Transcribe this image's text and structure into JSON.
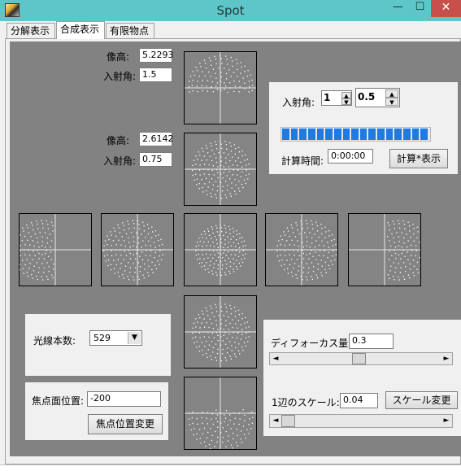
{
  "window": {
    "title": "Spot",
    "minimize_glyph": "—",
    "maximize_glyph": "☐",
    "close_glyph": "✕",
    "icon": "app-icon"
  },
  "tabs": [
    {
      "label": "分解表示",
      "selected": false
    },
    {
      "label": "合成表示",
      "selected": true
    },
    {
      "label": "有限物点",
      "selected": false
    }
  ],
  "top_spot": {
    "image_height_label": "像高:",
    "image_height_value": "5.2293",
    "incident_angle_label": "入射角:",
    "incident_angle_value": "1.5"
  },
  "mid_spot": {
    "image_height_label": "像高:",
    "image_height_value": "2.6142",
    "incident_angle_label": "入射角:",
    "incident_angle_value": "0.75"
  },
  "calc_panel": {
    "incident_angle_label": "入射角:",
    "spin1_value": "1",
    "spin2_value": "0.5",
    "progress_percent": 100,
    "progress_segments": 17,
    "calc_time_label": "計算時間:",
    "calc_time_value": "0:00:00",
    "calc_button": "計算*表示"
  },
  "rays_panel": {
    "label": "光線本数:",
    "selected": "529"
  },
  "focus_panel": {
    "label": "焦点面位置:",
    "value": "-200",
    "button": "焦点位置変更"
  },
  "defocus_panel": {
    "defocus_label": "ディフォーカス量:",
    "defocus_value": "0.3",
    "scale_label": "1辺のスケール:",
    "scale_value": "0.04",
    "scale_button": "スケール変更",
    "scroll_left_glyph": "◄",
    "scroll_right_glyph": "►",
    "defocus_scroll_fraction": 0.48,
    "scale_scroll_fraction": 0.0
  },
  "colors": {
    "titlebar": "#5ec6c9",
    "close_button": "#c7504a",
    "plot_background": "#828282",
    "spot_dots": "#ffffff",
    "progress": "#1e7be0"
  }
}
